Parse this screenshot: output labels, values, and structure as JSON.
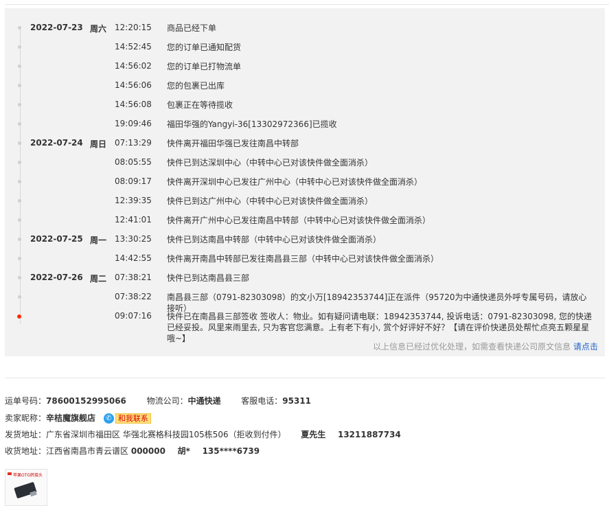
{
  "tracking": [
    {
      "date": "2022-07-23",
      "week": "周六",
      "time": "12:20:15",
      "desc": "商品已经下单"
    },
    {
      "date": "",
      "week": "",
      "time": "14:52:45",
      "desc": "您的订单已通知配货"
    },
    {
      "date": "",
      "week": "",
      "time": "14:56:02",
      "desc": "您的订单已打物流单"
    },
    {
      "date": "",
      "week": "",
      "time": "14:56:06",
      "desc": "您的包裹已出库"
    },
    {
      "date": "",
      "week": "",
      "time": "14:56:08",
      "desc": "包裹正在等待揽收"
    },
    {
      "date": "",
      "week": "",
      "time": "19:09:46",
      "desc": "福田华强的Yangyi-36[13302972366]已揽收"
    },
    {
      "date": "2022-07-24",
      "week": "周日",
      "time": "07:13:29",
      "desc": "快件离开福田华强已发往南昌中转部"
    },
    {
      "date": "",
      "week": "",
      "time": "08:05:55",
      "desc": "快件已到达深圳中心（中转中心已对该快件做全面消杀）"
    },
    {
      "date": "",
      "week": "",
      "time": "08:09:17",
      "desc": "快件离开深圳中心已发往广州中心（中转中心已对该快件做全面消杀）"
    },
    {
      "date": "",
      "week": "",
      "time": "12:39:35",
      "desc": "快件已到达广州中心（中转中心已对该快件做全面消杀）"
    },
    {
      "date": "",
      "week": "",
      "time": "12:41:01",
      "desc": "快件离开广州中心已发往南昌中转部（中转中心已对该快件做全面消杀）"
    },
    {
      "date": "2022-07-25",
      "week": "周一",
      "time": "13:30:25",
      "desc": "快件已到达南昌中转部（中转中心已对该快件做全面消杀）"
    },
    {
      "date": "",
      "week": "",
      "time": "14:42:55",
      "desc": "快件离开南昌中转部已发往南昌县三部（中转中心已对该快件做全面消杀）"
    },
    {
      "date": "2022-07-26",
      "week": "周二",
      "time": "07:38:21",
      "desc": "快件已到达南昌县三部"
    },
    {
      "date": "",
      "week": "",
      "time": "07:38:22",
      "desc": "南昌县三部（0791-82303098）的文小万[18942353744]正在派件（95720为中通快递员外呼专属号码，请放心接听）"
    },
    {
      "date": "",
      "week": "",
      "time": "09:07:16",
      "desc": "快件已在南昌县三部签收 签收人：物业。如有疑问请电联：18942353744, 投诉电话：0791-82303098, 您的快递已经妥投。风里来雨里去, 只为客官您满意。上有老下有小, 赏个好评好不好？【请在评价快递员处帮忙点亮五颗星星哦~】"
    }
  ],
  "note": {
    "text": "以上信息已经过优化处理，如需查看快递公司原文信息 ",
    "link": "请点击"
  },
  "info": {
    "waybill_label": "运单号码：",
    "waybill": "78600152995066",
    "company_label": "物流公司：",
    "company": "中通快递",
    "phone_label": "客服电话：",
    "phone": "95311",
    "seller_label": "卖家昵称：",
    "seller": "辛桔魔旗舰店",
    "contact_label": "和我联系",
    "ship_label": "发货地址：",
    "ship_addr": "广东省深圳市福田区 华强北赛格科技园105栋506（拒收到付件）",
    "ship_name": "夏先生",
    "ship_phone": "13211887734",
    "recv_label": "收货地址：",
    "recv_addr": "江西省南昌市青云谱区",
    "recv_zip": "000000",
    "recv_name": "胡*",
    "recv_phone": "135****6739"
  },
  "product": {
    "title": "苹果OTG转接头"
  },
  "colors": {
    "active_dot": "#ff2a00",
    "link": "#2262c6",
    "contact_badge": "#ffe27a"
  }
}
